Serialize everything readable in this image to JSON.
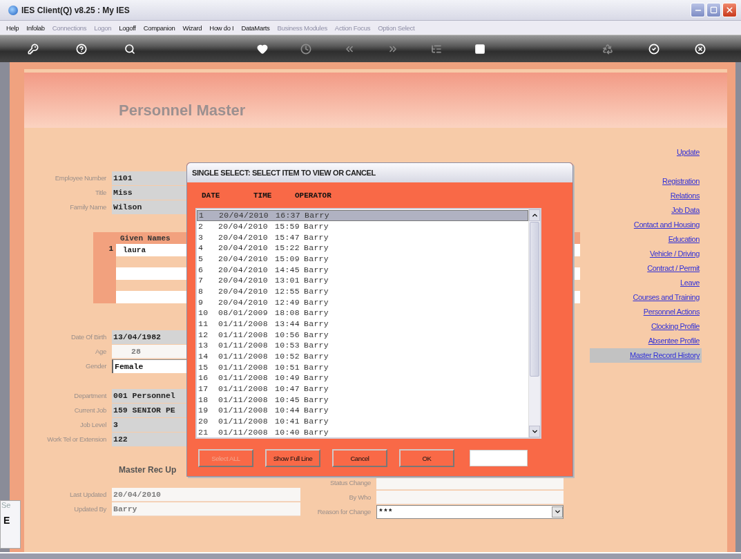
{
  "window": {
    "title": "IES Client(Q) v8.25 : My IES"
  },
  "menu": [
    {
      "label": "Help",
      "disabled": false
    },
    {
      "label": "Infolab",
      "disabled": false
    },
    {
      "label": "Connections",
      "disabled": true
    },
    {
      "label": "Logon",
      "disabled": true
    },
    {
      "label": "Logoff",
      "disabled": false
    },
    {
      "label": "Companion",
      "disabled": false
    },
    {
      "label": "Wizard",
      "disabled": false
    },
    {
      "label": "How do I",
      "disabled": false
    },
    {
      "label": "DataMarts",
      "disabled": false
    },
    {
      "label": "Business Modules",
      "disabled": true
    },
    {
      "label": "Action Focus",
      "disabled": true
    },
    {
      "label": "Option Select",
      "disabled": true
    }
  ],
  "toolbar": {
    "left": [
      {
        "kind": "key",
        "disabled": false
      },
      {
        "kind": "help",
        "disabled": false
      },
      {
        "kind": "search",
        "disabled": false
      }
    ],
    "middle": [
      {
        "kind": "heart",
        "disabled": false
      },
      {
        "kind": "clock",
        "disabled": true
      },
      {
        "kind": "back",
        "disabled": true
      },
      {
        "kind": "forward",
        "disabled": true
      },
      {
        "kind": "tree",
        "disabled": true
      },
      {
        "kind": "stop",
        "disabled": false
      }
    ],
    "right": [
      {
        "kind": "recycle",
        "disabled": true
      },
      {
        "kind": "check",
        "disabled": false
      },
      {
        "kind": "close",
        "disabled": false
      }
    ]
  },
  "page": {
    "title": "Personnel Master"
  },
  "fields_top": [
    {
      "label": "Employee Number",
      "value": "1101",
      "kind": "grey"
    },
    {
      "label": "Title",
      "value": "Miss",
      "kind": "grey"
    },
    {
      "label": "Family Name",
      "value": "Wilson",
      "kind": "grey"
    }
  ],
  "given_names": {
    "heading": "Given Names",
    "rows": [
      {
        "no": "1",
        "value": "laura"
      }
    ]
  },
  "fields_personal": [
    {
      "label": "Date Of Birth",
      "value": "13/04/1982",
      "kind": "grey"
    },
    {
      "label": "Age",
      "value": "28",
      "kind": "light"
    },
    {
      "label": "Gender",
      "value": "Female",
      "kind": "input"
    }
  ],
  "fields_job": [
    {
      "label": "Department",
      "value": "001 Personnel",
      "kind": "grey"
    },
    {
      "label": "Current Job",
      "value": "159 SENIOR PE",
      "kind": "grey"
    },
    {
      "label": "Job Level",
      "value": "3",
      "kind": "grey"
    },
    {
      "label": "Work Tel or Extension",
      "value": "122",
      "kind": "grey"
    }
  ],
  "update_section": {
    "heading": "Master Rec Up",
    "left": [
      {
        "label": "Last Updated",
        "value": "20/04/2010",
        "kind": "light"
      },
      {
        "label": "Updated By",
        "value": "Barry",
        "kind": "light"
      }
    ],
    "right": [
      {
        "label": "Status Change",
        "kind": "light"
      },
      {
        "label": "By Who",
        "kind": "light"
      },
      {
        "label": "Reason for Change",
        "value": "***",
        "kind": "dropdown"
      }
    ]
  },
  "links": {
    "top": [
      {
        "label": "Update",
        "selected": false
      }
    ],
    "main": [
      {
        "label": "Registration",
        "selected": false
      },
      {
        "label": "Relations",
        "selected": false
      },
      {
        "label": "Job Data",
        "selected": false
      },
      {
        "label": "Contact and Housing",
        "selected": false
      },
      {
        "label": "Education",
        "selected": false
      },
      {
        "label": "Vehicle / Driving",
        "selected": false
      },
      {
        "label": "Contract / Permit",
        "selected": false
      },
      {
        "label": "Leave",
        "selected": false
      },
      {
        "label": "Courses and Training",
        "selected": false
      },
      {
        "label": "Personnel Actions",
        "selected": false
      },
      {
        "label": "Clocking Profile",
        "selected": false
      },
      {
        "label": "Absentee Profile",
        "selected": false
      },
      {
        "label": "Master Record History",
        "selected": true
      }
    ]
  },
  "dialog": {
    "title": "SINGLE SELECT: SELECT ITEM TO VIEW OR CANCEL",
    "columns": [
      "DATE",
      "TIME",
      "OPERATOR"
    ],
    "rows": [
      {
        "no": "1",
        "date": "20/04/2010",
        "time": "16:37",
        "operator": "Barry",
        "selected": true
      },
      {
        "no": "2",
        "date": "20/04/2010",
        "time": "15:59",
        "operator": "Barry",
        "selected": false
      },
      {
        "no": "3",
        "date": "20/04/2010",
        "time": "15:47",
        "operator": "Barry",
        "selected": false
      },
      {
        "no": "4",
        "date": "20/04/2010",
        "time": "15:22",
        "operator": "Barry",
        "selected": false
      },
      {
        "no": "5",
        "date": "20/04/2010",
        "time": "15:09",
        "operator": "Barry",
        "selected": false
      },
      {
        "no": "6",
        "date": "20/04/2010",
        "time": "14:45",
        "operator": "Barry",
        "selected": false
      },
      {
        "no": "7",
        "date": "20/04/2010",
        "time": "13:01",
        "operator": "Barry",
        "selected": false
      },
      {
        "no": "8",
        "date": "20/04/2010",
        "time": "12:55",
        "operator": "Barry",
        "selected": false
      },
      {
        "no": "9",
        "date": "20/04/2010",
        "time": "12:49",
        "operator": "Barry",
        "selected": false
      },
      {
        "no": "10",
        "date": "08/01/2009",
        "time": "18:08",
        "operator": "Barry",
        "selected": false
      },
      {
        "no": "11",
        "date": "01/11/2008",
        "time": "13:44",
        "operator": "Barry",
        "selected": false
      },
      {
        "no": "12",
        "date": "01/11/2008",
        "time": "10:56",
        "operator": "Barry",
        "selected": false
      },
      {
        "no": "13",
        "date": "01/11/2008",
        "time": "10:53",
        "operator": "Barry",
        "selected": false
      },
      {
        "no": "14",
        "date": "01/11/2008",
        "time": "10:52",
        "operator": "Barry",
        "selected": false
      },
      {
        "no": "15",
        "date": "01/11/2008",
        "time": "10:51",
        "operator": "Barry",
        "selected": false
      },
      {
        "no": "16",
        "date": "01/11/2008",
        "time": "10:49",
        "operator": "Barry",
        "selected": false
      },
      {
        "no": "17",
        "date": "01/11/2008",
        "time": "10:47",
        "operator": "Barry",
        "selected": false
      },
      {
        "no": "18",
        "date": "01/11/2008",
        "time": "10:45",
        "operator": "Barry",
        "selected": false
      },
      {
        "no": "19",
        "date": "01/11/2008",
        "time": "10:44",
        "operator": "Barry",
        "selected": false
      },
      {
        "no": "20",
        "date": "01/11/2008",
        "time": "10:41",
        "operator": "Barry",
        "selected": false
      },
      {
        "no": "21",
        "date": "01/11/2008",
        "time": "10:40",
        "operator": "Barry",
        "selected": false
      }
    ],
    "buttons": [
      {
        "label": "Select ALL",
        "disabled": true
      },
      {
        "label": "Show Full Line",
        "disabled": false
      },
      {
        "label": "Cancel",
        "disabled": false
      },
      {
        "label": "OK",
        "disabled": false
      }
    ]
  },
  "side_panel": {
    "tab": "Se",
    "label": "E"
  }
}
